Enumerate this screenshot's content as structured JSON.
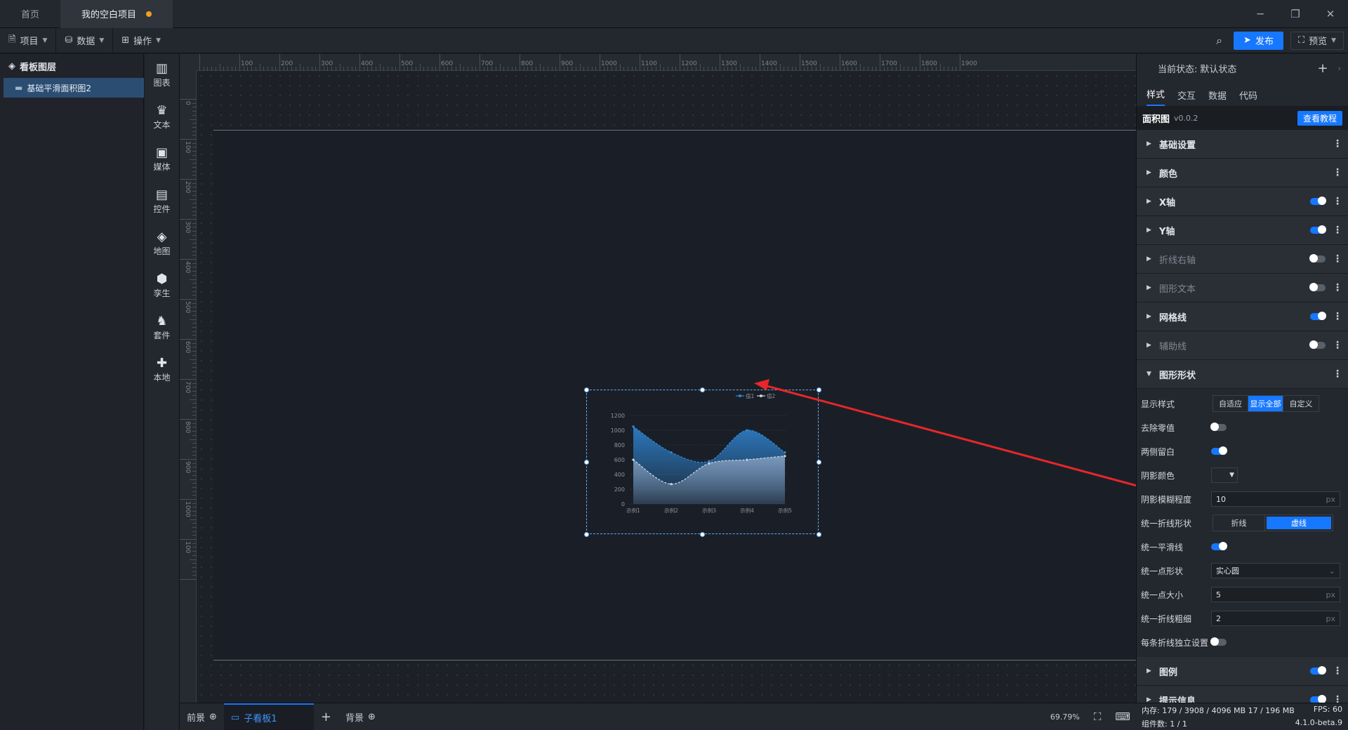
{
  "tabs": [
    {
      "label": "首页"
    },
    {
      "label": "我的空白项目"
    }
  ],
  "window": {
    "minimize": "─",
    "restore": "❐",
    "close": "✕"
  },
  "toolbar": {
    "project": "项目",
    "data": "数据",
    "operate": "操作",
    "publish": "发布",
    "preview": "预览"
  },
  "layers": {
    "title": "看板图层",
    "items": [
      {
        "label": "基础平滑面积图2"
      }
    ]
  },
  "components": [
    {
      "label": "图表",
      "icon": "chart-icon",
      "glyph": "▥"
    },
    {
      "label": "文本",
      "icon": "text-icon",
      "glyph": "♛"
    },
    {
      "label": "媒体",
      "icon": "media-icon",
      "glyph": "▣"
    },
    {
      "label": "控件",
      "icon": "control-icon",
      "glyph": "▤"
    },
    {
      "label": "地图",
      "icon": "map-icon",
      "glyph": "◈"
    },
    {
      "label": "孪生",
      "icon": "twin-icon",
      "glyph": "⬢"
    },
    {
      "label": "套件",
      "icon": "kit-icon",
      "glyph": "♞"
    },
    {
      "label": "本地",
      "icon": "local-icon",
      "glyph": "✚"
    }
  ],
  "ruler": {
    "top": [
      "100",
      "200",
      "300",
      "400",
      "500",
      "600",
      "700",
      "800",
      "900",
      "1000",
      "1100",
      "1200",
      "1300",
      "1400",
      "1500",
      "1600",
      "1700",
      "1800",
      "1900"
    ],
    "left": [
      "0",
      "100",
      "200",
      "300",
      "400",
      "500",
      "600",
      "700",
      "800",
      "900",
      "1000",
      "100"
    ]
  },
  "chart_data": {
    "type": "area",
    "categories": [
      "示例1",
      "示例2",
      "示例3",
      "示例4",
      "示例5"
    ],
    "series": [
      {
        "name": "值1",
        "values": [
          1050,
          700,
          580,
          1000,
          700
        ]
      },
      {
        "name": "值2",
        "values": [
          600,
          270,
          550,
          600,
          650
        ]
      }
    ],
    "ylim": [
      0,
      1200
    ],
    "yticks": [
      "0",
      "200",
      "400",
      "600",
      "800",
      "1000",
      "1200"
    ],
    "legend": "top-right",
    "smooth": true,
    "colors": {
      "s1": "#2f88d8",
      "s2": "#c8d4e6"
    }
  },
  "panel": {
    "state_label": "当前状态:",
    "state_value": "默认状态",
    "tabs": [
      "样式",
      "交互",
      "数据",
      "代码"
    ],
    "component_name": "面积图",
    "version": "v0.0.2",
    "tutorial": "查看教程",
    "sections": [
      {
        "label": "基础设置",
        "toggle": null,
        "dim": false
      },
      {
        "label": "颜色",
        "toggle": null,
        "dim": false
      },
      {
        "label": "X轴",
        "toggle": true,
        "dim": false
      },
      {
        "label": "Y轴",
        "toggle": true,
        "dim": false
      },
      {
        "label": "折线右轴",
        "toggle": false,
        "dim": true
      },
      {
        "label": "图形文本",
        "toggle": false,
        "dim": true
      },
      {
        "label": "网格线",
        "toggle": true,
        "dim": false
      },
      {
        "label": "辅助线",
        "toggle": false,
        "dim": true
      }
    ],
    "shape_section": "图形形状",
    "display_style": {
      "label": "显示样式",
      "options": [
        "自适应",
        "显示全部",
        "自定义"
      ],
      "selected": "显示全部"
    },
    "remove_zero": {
      "label": "去除零值",
      "on": false
    },
    "both_blank": {
      "label": "两侧留白",
      "on": true
    },
    "shadow_color": {
      "label": "阴影颜色"
    },
    "shadow_blur": {
      "label": "阴影模糊程度",
      "value": "10",
      "unit": "px"
    },
    "line_shape": {
      "label": "统一折线形状",
      "options": [
        "折线",
        "虚线"
      ],
      "selected": "虚线"
    },
    "smooth_line": {
      "label": "统一平滑线",
      "on": true
    },
    "point_shape": {
      "label": "统一点形状",
      "value": "实心圆"
    },
    "point_size": {
      "label": "统一点大小",
      "value": "5",
      "unit": "px"
    },
    "line_width": {
      "label": "统一折线粗细",
      "value": "2",
      "unit": "px"
    },
    "independent": {
      "label": "每条折线独立设置",
      "on": false
    },
    "legend_section": "图例",
    "tooltip_section": "提示信息"
  },
  "bottom": {
    "front": "前景",
    "sub_board": "子看板1",
    "add": "+",
    "background": "背景",
    "zoom": "69.79%"
  },
  "status": {
    "memory": "内存: 179 / 3908 / 4096 MB 17 / 196 MB",
    "fps": "FPS: 60",
    "components": "组件数: 1 / 1",
    "version": "4.1.0-beta.9"
  }
}
